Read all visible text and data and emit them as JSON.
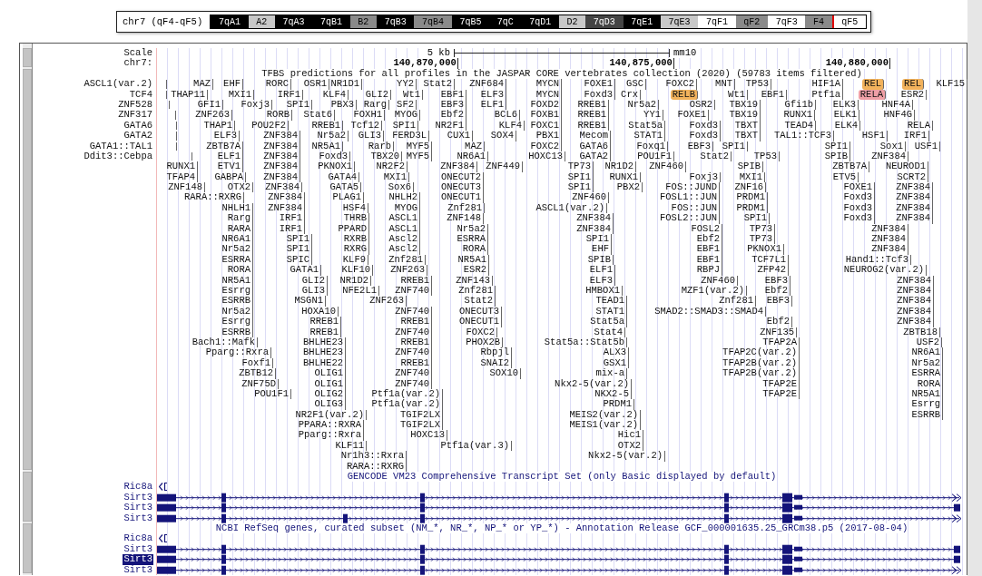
{
  "ideogram": {
    "title": "chr7 (qF4-qF5)",
    "bands": [
      {
        "label": "7qA1",
        "color": "#000000"
      },
      {
        "label": "A2",
        "color": "#c8c8c8"
      },
      {
        "label": "7qA3",
        "color": "#000000"
      },
      {
        "label": "7qB1",
        "color": "#000000"
      },
      {
        "label": "B2",
        "color": "#8a8a8a"
      },
      {
        "label": "7qB3",
        "color": "#000000"
      },
      {
        "label": "7qB4",
        "color": "#8a8a8a"
      },
      {
        "label": "7qB5",
        "color": "#000000"
      },
      {
        "label": "7qC",
        "color": "#000000"
      },
      {
        "label": "7qD1",
        "color": "#000000"
      },
      {
        "label": "D2",
        "color": "#c8c8c8"
      },
      {
        "label": "7qD3",
        "color": "#444444"
      },
      {
        "label": "7qE1",
        "color": "#000000"
      },
      {
        "label": "7qE3",
        "color": "#c8c8c8"
      },
      {
        "label": "7qF1",
        "color": "#ffffff"
      },
      {
        "label": "qF2",
        "color": "#8a8a8a"
      },
      {
        "label": "7qF3",
        "color": "#ffffff"
      },
      {
        "label": "F4",
        "color": "#8a8a8a"
      },
      {
        "label": "qF5",
        "color": "#ffffff"
      }
    ]
  },
  "ruler": {
    "scale_label": "Scale",
    "scale_length": "5 kb",
    "assembly": "mm10",
    "chrom_label": "chr7:",
    "positions": [
      "140,870,000",
      "140,875,000",
      "140,880,000"
    ]
  },
  "tfbs": {
    "title": "TFBS predictions for all profiles in the JASPAR CORE vertebrates collection (2020) (59783 items filtered)",
    "rows": [
      {
        "left_label": "ASCL1(var.2)",
        "items": [
          {
            "name": "MAZ"
          },
          {
            "name": "EHF"
          },
          {
            "name": "RORC"
          },
          {
            "name": "OSR1"
          },
          {
            "name": "NR1D1"
          },
          {
            "name": "YY2"
          },
          {
            "name": "Stat2"
          },
          {
            "name": "ZNF684"
          },
          {
            "name": "MYCN"
          },
          {
            "name": "FOXE1"
          },
          {
            "name": "GSC"
          },
          {
            "name": "FOXC2"
          },
          {
            "name": "MNT"
          },
          {
            "name": "TP53"
          },
          {
            "name": "HIF1A"
          },
          {
            "name": "REL",
            "color": "#f2b25c"
          },
          {
            "name": "REL",
            "color": "#f2b25c"
          },
          {
            "name": "KLF15"
          }
        ]
      },
      {
        "left_label": "TCF4",
        "items": [
          {
            "name": "THAP11"
          },
          {
            "name": "MXI1"
          },
          {
            "name": "IRF1"
          },
          {
            "name": "KLF4"
          },
          {
            "name": "GLI2"
          },
          {
            "name": "Wt1"
          },
          {
            "name": "EBF1"
          },
          {
            "name": "ELF3"
          },
          {
            "name": "MYCN"
          },
          {
            "name": "Foxd3"
          },
          {
            "name": "Crx"
          },
          {
            "name": "RELB",
            "color": "#f2b25c"
          },
          {
            "name": "Wt1"
          },
          {
            "name": "EBF1"
          },
          {
            "name": "Ptf1a"
          },
          {
            "name": "RELA",
            "color": "#ef9fa6"
          },
          {
            "name": "ESR2"
          }
        ]
      },
      {
        "left_label": "ZNF528",
        "items": [
          {
            "name": "GFI1"
          },
          {
            "name": "Foxj3"
          },
          {
            "name": "SPI1"
          },
          {
            "name": "PBX3"
          },
          {
            "name": "Rarg"
          },
          {
            "name": "SF2"
          },
          {
            "name": "EBF3"
          },
          {
            "name": "ELF1"
          },
          {
            "name": "FOXD2"
          },
          {
            "name": "RREB1"
          },
          {
            "name": "Nr5a2"
          },
          {
            "name": "OSR2"
          },
          {
            "name": "TBX19"
          },
          {
            "name": "Gfi1b"
          },
          {
            "name": "ELK3"
          },
          {
            "name": "HNF4A"
          }
        ]
      },
      {
        "left_label": "ZNF317",
        "items": [
          {
            "name": "ZNF263"
          },
          {
            "name": "RORB"
          },
          {
            "name": "Stat6"
          },
          {
            "name": "FOXH1"
          },
          {
            "name": "MYOG"
          },
          {
            "name": "Ebf2"
          },
          {
            "name": "BCL6"
          },
          {
            "name": "FOXB1"
          },
          {
            "name": "RREB1"
          },
          {
            "name": "YY1"
          },
          {
            "name": "FOXE1"
          },
          {
            "name": "TBX19"
          },
          {
            "name": "RUNX1"
          },
          {
            "name": "ELK1"
          },
          {
            "name": "HNF4G"
          }
        ]
      },
      {
        "left_label": "GATA6",
        "items": [
          {
            "name": "THAP1"
          },
          {
            "name": "POU2F2"
          },
          {
            "name": "RREB1"
          },
          {
            "name": "Tcf12"
          },
          {
            "name": "SPI1"
          },
          {
            "name": "NR2F1"
          },
          {
            "name": "KLF4"
          },
          {
            "name": "FOXC1"
          },
          {
            "name": "RREB1"
          },
          {
            "name": "Stat5a"
          },
          {
            "name": "Foxd3"
          },
          {
            "name": "TBXT"
          },
          {
            "name": "TEAD4"
          },
          {
            "name": "ELK4"
          },
          {
            "name": "RELA"
          }
        ]
      },
      {
        "left_label": "GATA2",
        "items": [
          {
            "name": "ELF3"
          },
          {
            "name": "ZNF384"
          },
          {
            "name": "Nr5a2"
          },
          {
            "name": "GLI3"
          },
          {
            "name": "FERD3L"
          },
          {
            "name": "CUX1"
          },
          {
            "name": "SOX4"
          },
          {
            "name": "PBX1"
          },
          {
            "name": "Mecom"
          },
          {
            "name": "STAT1"
          },
          {
            "name": "Foxd3"
          },
          {
            "name": "TBXT"
          },
          {
            "name": "TAL1::TCF3"
          },
          {
            "name": "HSF1"
          },
          {
            "name": "IRF1"
          }
        ]
      },
      {
        "left_label": "GATA1::TAL1",
        "items": [
          {
            "name": "ZBTB7A"
          },
          {
            "name": "ZNF384"
          },
          {
            "name": "NR5A1"
          },
          {
            "name": "Rarb"
          },
          {
            "name": "MYF5"
          },
          {
            "name": "MAZ"
          },
          {
            "name": "FOXC2"
          },
          {
            "name": "GATA6"
          },
          {
            "name": "Foxq1"
          },
          {
            "name": "EBF3"
          },
          {
            "name": "SPI1"
          },
          {
            "name": "SPI1"
          },
          {
            "name": "Sox1"
          },
          {
            "name": "USF1"
          }
        ]
      },
      {
        "left_label": "Ddit3::Cebpa",
        "items": [
          {
            "name": "ELF1"
          },
          {
            "name": "ZNF384"
          },
          {
            "name": "Foxd3"
          },
          {
            "name": "TBX20"
          },
          {
            "name": "MYF5"
          },
          {
            "name": "NR6A1"
          },
          {
            "name": "HOXC13"
          },
          {
            "name": "GATA2"
          },
          {
            "name": "POU1F1"
          },
          {
            "name": "Stat2"
          },
          {
            "name": "TP53"
          },
          {
            "name": "SPIB"
          },
          {
            "name": "ZNF384"
          }
        ]
      },
      {
        "items": [
          {
            "name": "RUNX1"
          },
          {
            "name": "ETV1"
          },
          {
            "name": "ZNF384"
          },
          {
            "name": "PKNOX1"
          },
          {
            "name": "NR2F2"
          },
          {
            "name": "ZNF384"
          },
          {
            "name": "ZNF449"
          },
          {
            "name": "TP73"
          },
          {
            "name": "NR1D2"
          },
          {
            "name": "ZNF460"
          },
          {
            "name": "SPIB"
          },
          {
            "name": "ZBTB7A"
          },
          {
            "name": "NEUROD1"
          }
        ]
      },
      {
        "items": [
          {
            "name": "TFAP4"
          },
          {
            "name": "GABPA"
          },
          {
            "name": "ZNF384"
          },
          {
            "name": "GATA4"
          },
          {
            "name": "MXI1"
          },
          {
            "name": "ONECUT2"
          },
          {
            "name": "SPI1"
          },
          {
            "name": "RUNX1"
          },
          {
            "name": "Foxj3"
          },
          {
            "name": "MXI1"
          },
          {
            "name": "ETV5"
          },
          {
            "name": "SCRT2"
          }
        ]
      },
      {
        "items": [
          {
            "name": "ZNF148"
          },
          {
            "name": "OTX2"
          },
          {
            "name": "ZNF384"
          },
          {
            "name": "GATA5"
          },
          {
            "name": "Sox6"
          },
          {
            "name": "ONECUT3"
          },
          {
            "name": "SPI1"
          },
          {
            "name": "PBX2"
          },
          {
            "name": "FOS::JUND"
          },
          {
            "name": "ZNF16"
          },
          {
            "name": "FOXE1"
          },
          {
            "name": "ZNF384"
          }
        ]
      },
      {
        "items": [
          {
            "name": "RARA::RXRG"
          },
          {
            "name": "ZNF384"
          },
          {
            "name": "PLAG1"
          },
          {
            "name": "NHLH2"
          },
          {
            "name": "ONECUT1"
          },
          {
            "name": "ZNF460"
          },
          {
            "name": "FOSL1::JUN"
          },
          {
            "name": "PRDM1"
          },
          {
            "name": "Foxd3"
          },
          {
            "name": "ZNF384"
          }
        ]
      },
      {
        "items": [
          {
            "name": "NHLH1"
          },
          {
            "name": "ZNF384"
          },
          {
            "name": "HSF4"
          },
          {
            "name": "MYOG"
          },
          {
            "name": "Znf281"
          },
          {
            "name": "ASCL1(var.2)"
          },
          {
            "name": "FOS::JUN"
          },
          {
            "name": "PRDM1"
          },
          {
            "name": "Foxd3"
          },
          {
            "name": "ZNF384"
          }
        ]
      },
      {
        "items": [
          {
            "name": "Rarg"
          },
          {
            "name": "IRF1"
          },
          {
            "name": "THRB"
          },
          {
            "name": "ASCL1"
          },
          {
            "name": "ZNF148"
          },
          {
            "name": "ZNF384"
          },
          {
            "name": "FOSL2::JUN"
          },
          {
            "name": "SPI1"
          },
          {
            "name": "Foxd3"
          },
          {
            "name": "ZNF384"
          }
        ]
      },
      {
        "items": [
          {
            "name": "RARA"
          },
          {
            "name": "IRF1"
          },
          {
            "name": "PPARD"
          },
          {
            "name": "ASCL1"
          },
          {
            "name": "Nr5a2"
          },
          {
            "name": "ZNF384"
          },
          {
            "name": "FOSL2"
          },
          {
            "name": "TP73"
          },
          {
            "name": "ZNF384"
          }
        ]
      },
      {
        "items": [
          {
            "name": "NR6A1"
          },
          {
            "name": "SPI1"
          },
          {
            "name": "RXRB"
          },
          {
            "name": "Ascl2"
          },
          {
            "name": "ESRRA"
          },
          {
            "name": "SPI1"
          },
          {
            "name": "Ebf2"
          },
          {
            "name": "TP73"
          },
          {
            "name": "ZNF384"
          }
        ]
      },
      {
        "items": [
          {
            "name": "Nr5a2"
          },
          {
            "name": "SPI1"
          },
          {
            "name": "RXRG"
          },
          {
            "name": "Ascl2"
          },
          {
            "name": "RORA"
          },
          {
            "name": "EHF"
          },
          {
            "name": "EBF1"
          },
          {
            "name": "PKNOX1"
          },
          {
            "name": "ZNF384"
          }
        ]
      },
      {
        "items": [
          {
            "name": "ESRRA"
          },
          {
            "name": "SPIC"
          },
          {
            "name": "KLF9"
          },
          {
            "name": "Znf281"
          },
          {
            "name": "NR5A1"
          },
          {
            "name": "SPIB"
          },
          {
            "name": "EBF1"
          },
          {
            "name": "TCF7L1"
          },
          {
            "name": "Hand1::Tcf3"
          }
        ]
      },
      {
        "items": [
          {
            "name": "RORA"
          },
          {
            "name": "GATA1"
          },
          {
            "name": "KLF10"
          },
          {
            "name": "ZNF263"
          },
          {
            "name": "ESR2"
          },
          {
            "name": "ELF1"
          },
          {
            "name": "RBPJ"
          },
          {
            "name": "ZFP42"
          },
          {
            "name": "NEUROG2(var.2)"
          }
        ]
      },
      {
        "items": [
          {
            "name": "NR5A1"
          },
          {
            "name": "GLI2"
          },
          {
            "name": "NR1D2"
          },
          {
            "name": "RREB1"
          },
          {
            "name": "ZNF143"
          },
          {
            "name": "ELF3"
          },
          {
            "name": "ZNF460"
          },
          {
            "name": "EBF3"
          },
          {
            "name": "ZNF384"
          }
        ]
      },
      {
        "items": [
          {
            "name": "Esrrg"
          },
          {
            "name": "GLI3"
          },
          {
            "name": "NFE2L1"
          },
          {
            "name": "ZNF740"
          },
          {
            "name": "Znf281"
          },
          {
            "name": "HMBOX1"
          },
          {
            "name": "MZF1(var.2)"
          },
          {
            "name": "Ebf2"
          },
          {
            "name": "ZNF384"
          }
        ]
      },
      {
        "items": [
          {
            "name": "ESRRB"
          },
          {
            "name": "MSGN1"
          },
          {
            "name": "ZNF263"
          },
          {
            "name": "Stat2"
          },
          {
            "name": "TEAD1"
          },
          {
            "name": "Znf281"
          },
          {
            "name": "EBF3"
          },
          {
            "name": "ZNF384"
          }
        ]
      },
      {
        "items": [
          {
            "name": "Nr5a2"
          },
          {
            "name": "HOXA10"
          },
          {
            "name": "ZNF740"
          },
          {
            "name": "ONECUT3"
          },
          {
            "name": "STAT1"
          },
          {
            "name": "SMAD2::SMAD3::SMAD4"
          },
          {
            "name": "ZNF384"
          }
        ]
      },
      {
        "items": [
          {
            "name": "Esrrg"
          },
          {
            "name": "RREB1"
          },
          {
            "name": "RREB1"
          },
          {
            "name": "ONECUT1"
          },
          {
            "name": "Stat5a"
          },
          {
            "name": "Ebf2"
          },
          {
            "name": "ZNF384"
          }
        ]
      },
      {
        "items": [
          {
            "name": "ESRRB"
          },
          {
            "name": "RREB1"
          },
          {
            "name": "ZNF740"
          },
          {
            "name": "FOXC2"
          },
          {
            "name": "Stat4"
          },
          {
            "name": "ZNF135"
          },
          {
            "name": "ZBTB18"
          }
        ]
      },
      {
        "items": [
          {
            "name": "Bach1::Mafk"
          },
          {
            "name": "BHLHE23"
          },
          {
            "name": "RREB1"
          },
          {
            "name": "PHOX2B"
          },
          {
            "name": "Stat5a::Stat5b"
          },
          {
            "name": "TFAP2A"
          },
          {
            "name": "USF2"
          }
        ]
      },
      {
        "items": [
          {
            "name": "Pparg::Rxra"
          },
          {
            "name": "BHLHE23"
          },
          {
            "name": "ZNF740"
          },
          {
            "name": "Rbpjl"
          },
          {
            "name": "ALX3"
          },
          {
            "name": "TFAP2C(var.2)"
          },
          {
            "name": "NR6A1"
          }
        ]
      },
      {
        "items": [
          {
            "name": "Foxf1"
          },
          {
            "name": "BHLHE22"
          },
          {
            "name": "RREB1"
          },
          {
            "name": "SNAI2"
          },
          {
            "name": "GSX1"
          },
          {
            "name": "TFAP2B(var.2)"
          },
          {
            "name": "Nr5a2"
          }
        ]
      },
      {
        "items": [
          {
            "name": "ZBTB12"
          },
          {
            "name": "OLIG1"
          },
          {
            "name": "ZNF740"
          },
          {
            "name": "SOX10"
          },
          {
            "name": "mix-a"
          },
          {
            "name": "TFAP2B(var.2)"
          },
          {
            "name": "ESRRA"
          }
        ]
      },
      {
        "items": [
          {
            "name": "ZNF75D"
          },
          {
            "name": "OLIG1"
          },
          {
            "name": "ZNF740"
          },
          {
            "name": "Nkx2-5(var.2)"
          },
          {
            "name": "TFAP2E"
          },
          {
            "name": "RORA"
          }
        ]
      },
      {
        "items": [
          {
            "name": "POU1F1"
          },
          {
            "name": "OLIG2"
          },
          {
            "name": "Ptf1a(var.2)"
          },
          {
            "name": "NKX2-5"
          },
          {
            "name": "TFAP2E"
          },
          {
            "name": "NR5A1"
          }
        ]
      },
      {
        "items": [
          {
            "name": "OLIG3"
          },
          {
            "name": "Ptf1a(var.2)"
          },
          {
            "name": "PRDM1"
          },
          {
            "name": "Esrrg"
          }
        ]
      },
      {
        "items": [
          {
            "name": "NR2F1(var.2)"
          },
          {
            "name": "TGIF2LX"
          },
          {
            "name": "MEIS2(var.2)"
          },
          {
            "name": "ESRRB"
          }
        ]
      },
      {
        "items": [
          {
            "name": "PPARA::RXRA"
          },
          {
            "name": "TGIF2LX"
          },
          {
            "name": "MEIS1(var.2)"
          }
        ]
      },
      {
        "items": [
          {
            "name": "Pparg::Rxra"
          },
          {
            "name": "HOXC13"
          },
          {
            "name": "Hic1"
          }
        ]
      },
      {
        "items": [
          {
            "name": "KLF11"
          },
          {
            "name": "Ptf1a(var.3)"
          },
          {
            "name": "OTX2"
          }
        ]
      },
      {
        "items": [
          {
            "name": "Nr1h3::Rxra"
          },
          {
            "name": "Nkx2-5(var.2)"
          }
        ]
      },
      {
        "items": [
          {
            "name": "RARA::RXRG"
          }
        ]
      }
    ]
  },
  "gene_tracks": [
    {
      "title": "GENCODE VM23 Comprehensive Transcript Set (only Basic displayed by default)",
      "genes": [
        {
          "name": "Ric8a",
          "kind": "partial",
          "selected": false
        },
        {
          "name": "Sirt3",
          "kind": "transcript",
          "selected": false,
          "extra_exon": false,
          "extends_right": true
        },
        {
          "name": "Sirt3",
          "kind": "transcript",
          "selected": false,
          "extra_exon": false,
          "extends_right": false
        },
        {
          "name": "Sirt3",
          "kind": "transcript",
          "selected": false,
          "extra_exon": true,
          "extends_right": true
        }
      ]
    },
    {
      "title": "NCBI RefSeq genes, curated subset (NM_*, NR_*, NP_* or YP_*) - Annotation Release GCF_000001635.25_GRCm38.p5 (2017-08-04)",
      "genes": [
        {
          "name": "Ric8a",
          "kind": "partial",
          "selected": false
        },
        {
          "name": "Sirt3",
          "kind": "transcript",
          "selected": false,
          "extra_exon": false,
          "extends_right": false
        },
        {
          "name": "Sirt3",
          "kind": "transcript",
          "selected": true,
          "extra_exon": false,
          "extends_right": false
        },
        {
          "name": "Sirt3",
          "kind": "transcript",
          "selected": false,
          "extra_exon": false,
          "extends_right": true
        }
      ]
    }
  ]
}
